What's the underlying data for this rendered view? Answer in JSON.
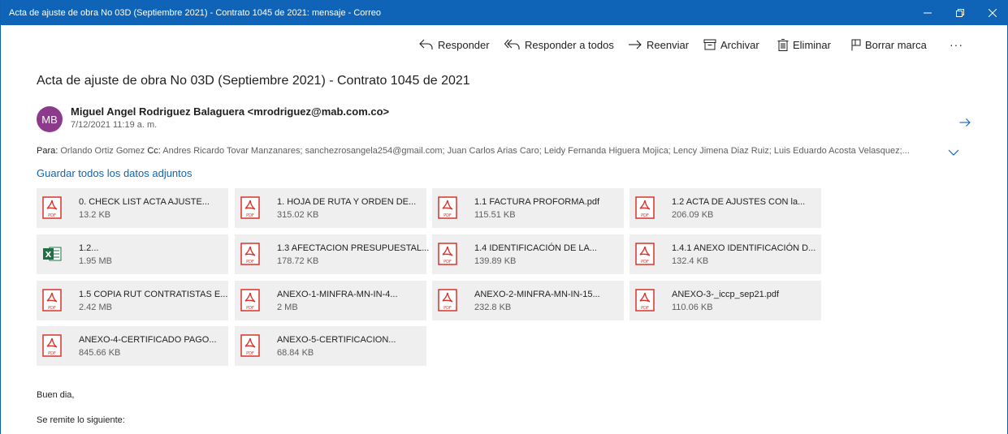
{
  "window": {
    "title": "Acta de ajuste de obra No 03D (Septiembre 2021) - Contrato 1045 de 2021: mensaje - Correo",
    "accent": "#0f64b8"
  },
  "toolbar": {
    "reply": "Responder",
    "reply_all": "Responder a todos",
    "forward": "Reenviar",
    "archive": "Archivar",
    "delete": "Eliminar",
    "clear_flag": "Borrar marca",
    "more": "···"
  },
  "message": {
    "subject": "Acta de ajuste de obra No 03D (Septiembre 2021) - Contrato 1045 de 2021",
    "avatar_initials": "MB",
    "avatar_color": "#8c3a8c",
    "sender": "Miguel Angel Rodriguez Balaguera <mrodriguez@mab.com.co>",
    "date": "7/12/2021 11:19 a. m.",
    "to_label": "Para:",
    "to": "Orlando Ortiz Gomez",
    "cc_label": "Cc:",
    "cc": "Andres Ricardo Tovar Manzanares; sanchezrosangela254@gmail.com; Juan Carlos Arias Caro; Leidy Fernanda Higuera Mojica; Lency Jimena Diaz Ruiz; Luis Eduardo Acosta Velasquez;...",
    "save_all": "Guardar todos los datos adjuntos",
    "body": [
      "Buen dia,",
      "Se remite lo siguiente:"
    ]
  },
  "attachments": [
    {
      "name": "0. CHECK LIST ACTA AJUSTE...",
      "size": "13.2 KB",
      "type": "pdf"
    },
    {
      "name": "1. HOJA DE RUTA Y ORDEN DE...",
      "size": "315.02 KB",
      "type": "pdf"
    },
    {
      "name": "1.1 FACTURA PROFORMA.pdf",
      "size": "115.51 KB",
      "type": "pdf"
    },
    {
      "name": "1.2 ACTA DE AJUSTES CON la...",
      "size": "206.09 KB",
      "type": "pdf"
    },
    {
      "name": "1.2...",
      "size": "1.95 MB",
      "type": "excel"
    },
    {
      "name": "1.3 AFECTACION PRESUPUESTAL...",
      "size": "178.72 KB",
      "type": "pdf"
    },
    {
      "name": "1.4 IDENTIFICACIÓN DE LA...",
      "size": "139.89 KB",
      "type": "pdf"
    },
    {
      "name": "1.4.1 ANEXO IDENTIFICACIÓN D...",
      "size": "132.4 KB",
      "type": "pdf"
    },
    {
      "name": "1.5 COPIA RUT CONTRATISTAS E...",
      "size": "2.42 MB",
      "type": "pdf"
    },
    {
      "name": "ANEXO-1-MINFRA-MN-IN-4...",
      "size": "2 MB",
      "type": "pdf"
    },
    {
      "name": "ANEXO-2-MINFRA-MN-IN-15...",
      "size": "232.8 KB",
      "type": "pdf"
    },
    {
      "name": "ANEXO-3-_iccp_sep21.pdf",
      "size": "110.06 KB",
      "type": "pdf"
    },
    {
      "name": "ANEXO-4-CERTIFICADO PAGO...",
      "size": "845.66 KB",
      "type": "pdf"
    },
    {
      "name": "ANEXO-5-CERTIFICACION...",
      "size": "68.84 KB",
      "type": "pdf"
    }
  ]
}
